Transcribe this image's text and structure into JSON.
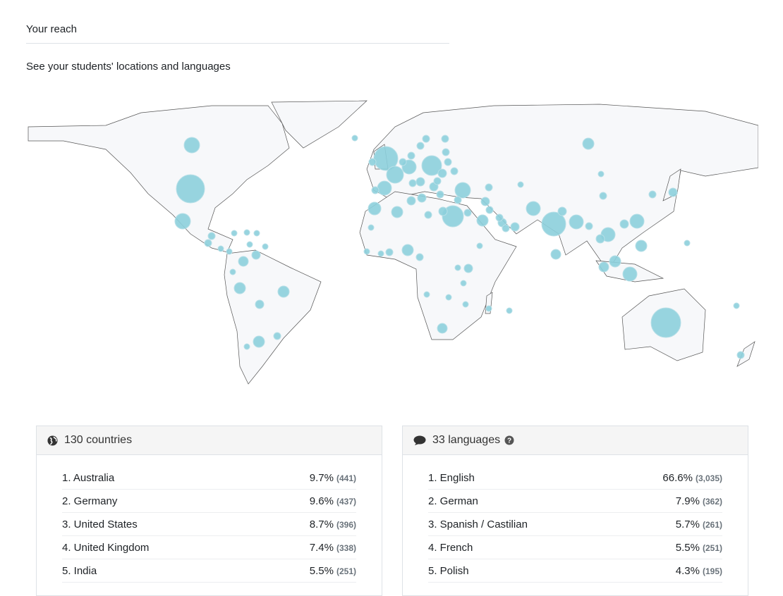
{
  "header": {
    "title": "Your reach",
    "subtitle": "See your students' locations and languages"
  },
  "colors": {
    "bubble": "#8ccfdc",
    "land": "#f7f8fa",
    "border": "#555555"
  },
  "countries": {
    "icon": "globe-icon",
    "heading": "130 countries",
    "items": [
      {
        "label": "1. Australia",
        "percent": "9.7%",
        "count": "(441)"
      },
      {
        "label": "2. Germany",
        "percent": "9.6%",
        "count": "(437)"
      },
      {
        "label": "3. United States",
        "percent": "8.7%",
        "count": "(396)"
      },
      {
        "label": "4. United Kingdom",
        "percent": "7.4%",
        "count": "(338)"
      },
      {
        "label": "5. India",
        "percent": "5.5%",
        "count": "(251)"
      }
    ]
  },
  "languages": {
    "icon": "comment-icon",
    "heading": "33 languages",
    "help_icon": "question-circle-icon",
    "items": [
      {
        "label": "1. English",
        "percent": "66.6%",
        "count": "(3,035)"
      },
      {
        "label": "2. German",
        "percent": "7.9%",
        "count": "(362)"
      },
      {
        "label": "3. Spanish / Castilian",
        "percent": "5.7%",
        "count": "(261)"
      },
      {
        "label": "4. French",
        "percent": "5.5%",
        "count": "(251)"
      },
      {
        "label": "5. Polish",
        "percent": "4.3%",
        "count": "(195)"
      }
    ]
  }
}
